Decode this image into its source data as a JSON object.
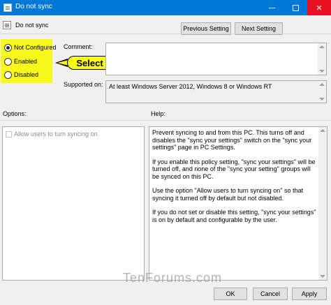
{
  "window": {
    "title": "Do not sync"
  },
  "policy": {
    "name": "Do not sync"
  },
  "nav": {
    "previous_label": "Previous Setting",
    "next_label": "Next Setting"
  },
  "state": {
    "options": [
      {
        "label": "Not Configured",
        "selected": true
      },
      {
        "label": "Enabled",
        "selected": false
      },
      {
        "label": "Disabled",
        "selected": false
      }
    ],
    "highlight_color": "#f8f81a"
  },
  "callout": {
    "text": "Select"
  },
  "comment": {
    "label": "Comment:",
    "value": ""
  },
  "supported": {
    "label": "Supported on:",
    "value": "At least Windows Server 2012, Windows 8 or Windows RT"
  },
  "options_section": {
    "label": "Options:",
    "checkbox_label": "Allow users to turn syncing on.",
    "checkbox_checked": false,
    "checkbox_enabled": false
  },
  "help_section": {
    "label": "Help:",
    "paragraphs": [
      "Prevent syncing to and from this PC.  This turns off and disables the \"sync your settings\" switch on the \"sync your settings\" page in PC Settings.",
      "If you enable this policy setting, \"sync your settings\" will be turned off, and none of the \"sync your setting\" groups will be synced on this PC.",
      "Use the option \"Allow users to turn syncing on\" so that syncing it turned off by default but not disabled.",
      "If you do not set or disable this setting, \"sync your settings\" is on by default and configurable by the user."
    ]
  },
  "buttons": {
    "ok": "OK",
    "cancel": "Cancel",
    "apply": "Apply"
  },
  "watermark": "TenForums.com",
  "colors": {
    "titlebar": "#0078d7",
    "close": "#e81123"
  }
}
